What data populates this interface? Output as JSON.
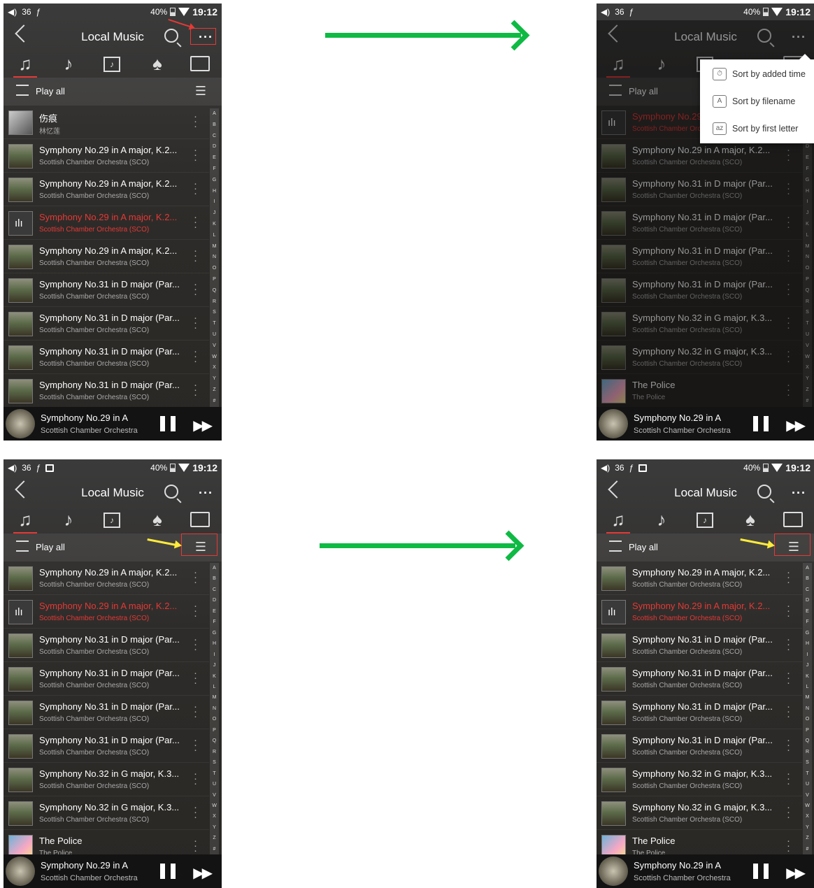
{
  "status": {
    "volume": "36",
    "battery": "40%",
    "time": "19:12"
  },
  "header": {
    "title": "Local Music",
    "more": "···"
  },
  "playall": {
    "label": "Play all"
  },
  "sort_menu": [
    "Sort by added time",
    "Sort by filename",
    "Sort by first letter"
  ],
  "index_letters": [
    "A",
    "B",
    "C",
    "D",
    "E",
    "F",
    "G",
    "H",
    "I",
    "J",
    "K",
    "L",
    "M",
    "N",
    "O",
    "P",
    "Q",
    "R",
    "S",
    "T",
    "U",
    "V",
    "W",
    "X",
    "Y",
    "Z",
    "#"
  ],
  "now_playing": {
    "title": "Symphony No.29 in A",
    "artist": "Scottish Chamber Orchestra"
  },
  "screens": [
    {
      "songs": [
        {
          "title": "伤痕",
          "artist": "林忆莲",
          "thumb": "photo"
        },
        {
          "title": "Symphony No.29 in A major, K.2...",
          "artist": "Scottish Chamber Orchestra (SCO)",
          "thumb": "landscape"
        },
        {
          "title": "Symphony No.29 in A major, K.2...",
          "artist": "Scottish Chamber Orchestra (SCO)",
          "thumb": "landscape"
        },
        {
          "title": "Symphony No.29 in A major, K.2...",
          "artist": "Scottish Chamber Orchestra (SCO)",
          "thumb": "eq",
          "playing": true
        },
        {
          "title": "Symphony No.29 in A major, K.2...",
          "artist": "Scottish Chamber Orchestra (SCO)",
          "thumb": "landscape"
        },
        {
          "title": "Symphony No.31 in D major (Par...",
          "artist": "Scottish Chamber Orchestra (SCO)",
          "thumb": "landscape"
        },
        {
          "title": "Symphony No.31 in D major (Par...",
          "artist": "Scottish Chamber Orchestra (SCO)",
          "thumb": "landscape"
        },
        {
          "title": "Symphony No.31 in D major (Par...",
          "artist": "Scottish Chamber Orchestra (SCO)",
          "thumb": "landscape"
        },
        {
          "title": "Symphony No.31 in D major (Par...",
          "artist": "Scottish Chamber Orchestra (SCO)",
          "thumb": "landscape"
        }
      ]
    },
    {
      "songs": [
        {
          "title": "Symphony No.29 in A major, K.2...",
          "artist": "Scottish Chamber Orchestra (SCO)",
          "thumb": "eq",
          "playing": true
        },
        {
          "title": "Symphony No.29 in A major, K.2...",
          "artist": "Scottish Chamber Orchestra (SCO)",
          "thumb": "landscape"
        },
        {
          "title": "Symphony No.31 in D major (Par...",
          "artist": "Scottish Chamber Orchestra (SCO)",
          "thumb": "landscape"
        },
        {
          "title": "Symphony No.31 in D major (Par...",
          "artist": "Scottish Chamber Orchestra (SCO)",
          "thumb": "landscape"
        },
        {
          "title": "Symphony No.31 in D major (Par...",
          "artist": "Scottish Chamber Orchestra (SCO)",
          "thumb": "landscape"
        },
        {
          "title": "Symphony No.31 in D major (Par...",
          "artist": "Scottish Chamber Orchestra (SCO)",
          "thumb": "landscape"
        },
        {
          "title": "Symphony No.32 in G major, K.3...",
          "artist": "Scottish Chamber Orchestra (SCO)",
          "thumb": "landscape"
        },
        {
          "title": "Symphony No.32 in G major, K.3...",
          "artist": "Scottish Chamber Orchestra (SCO)",
          "thumb": "landscape"
        },
        {
          "title": "The Police",
          "artist": "The Police",
          "thumb": "police"
        }
      ]
    },
    {
      "songs": [
        {
          "title": "Symphony No.29 in A major, K.2...",
          "artist": "Scottish Chamber Orchestra (SCO)",
          "thumb": "landscape"
        },
        {
          "title": "Symphony No.29 in A major, K.2...",
          "artist": "Scottish Chamber Orchestra (SCO)",
          "thumb": "eq",
          "playing": true
        },
        {
          "title": "Symphony No.31 in D major (Par...",
          "artist": "Scottish Chamber Orchestra (SCO)",
          "thumb": "landscape"
        },
        {
          "title": "Symphony No.31 in D major (Par...",
          "artist": "Scottish Chamber Orchestra (SCO)",
          "thumb": "landscape"
        },
        {
          "title": "Symphony No.31 in D major (Par...",
          "artist": "Scottish Chamber Orchestra (SCO)",
          "thumb": "landscape"
        },
        {
          "title": "Symphony No.31 in D major (Par...",
          "artist": "Scottish Chamber Orchestra (SCO)",
          "thumb": "landscape"
        },
        {
          "title": "Symphony No.32 in G major, K.3...",
          "artist": "Scottish Chamber Orchestra (SCO)",
          "thumb": "landscape"
        },
        {
          "title": "Symphony No.32 in G major, K.3...",
          "artist": "Scottish Chamber Orchestra (SCO)",
          "thumb": "landscape"
        },
        {
          "title": "The Police",
          "artist": "The Police",
          "thumb": "police"
        }
      ]
    },
    {
      "songs": [
        {
          "title": "Symphony No.29 in A major, K.2...",
          "artist": "Scottish Chamber Orchestra (SCO)",
          "thumb": "landscape"
        },
        {
          "title": "Symphony No.29 in A major, K.2...",
          "artist": "Scottish Chamber Orchestra (SCO)",
          "thumb": "eq",
          "playing": true
        },
        {
          "title": "Symphony No.31 in D major (Par...",
          "artist": "Scottish Chamber Orchestra (SCO)",
          "thumb": "landscape"
        },
        {
          "title": "Symphony No.31 in D major (Par...",
          "artist": "Scottish Chamber Orchestra (SCO)",
          "thumb": "landscape"
        },
        {
          "title": "Symphony No.31 in D major (Par...",
          "artist": "Scottish Chamber Orchestra (SCO)",
          "thumb": "landscape"
        },
        {
          "title": "Symphony No.31 in D major (Par...",
          "artist": "Scottish Chamber Orchestra (SCO)",
          "thumb": "landscape"
        },
        {
          "title": "Symphony No.32 in G major, K.3...",
          "artist": "Scottish Chamber Orchestra (SCO)",
          "thumb": "landscape"
        },
        {
          "title": "Symphony No.32 in G major, K.3...",
          "artist": "Scottish Chamber Orchestra (SCO)",
          "thumb": "landscape"
        },
        {
          "title": "The Police",
          "artist": "The Police",
          "thumb": "police"
        }
      ]
    }
  ]
}
